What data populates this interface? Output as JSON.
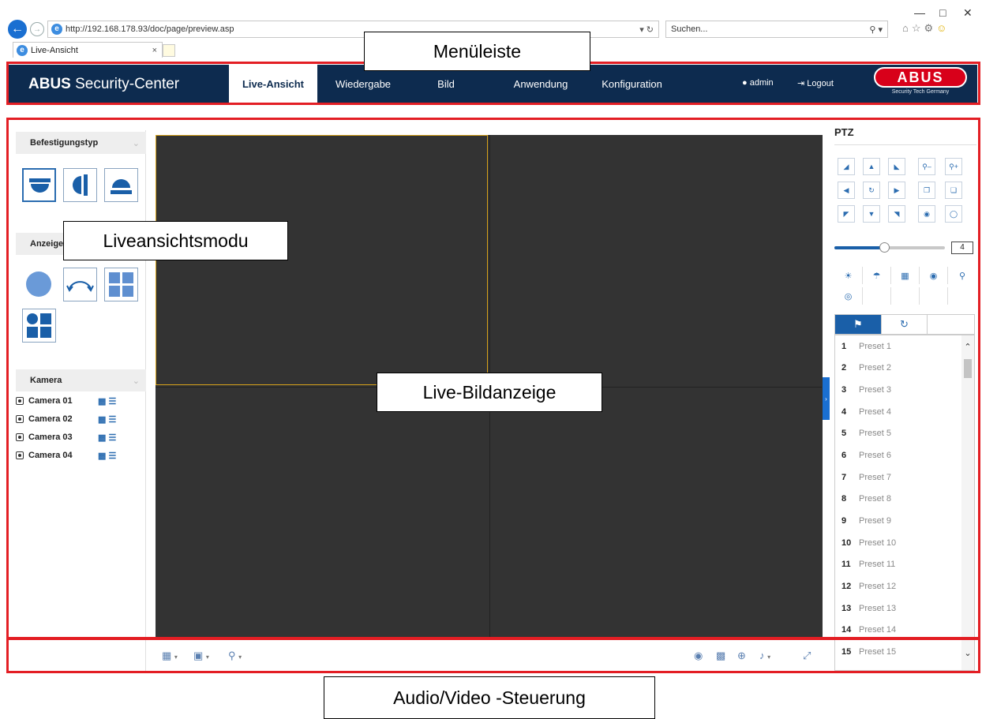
{
  "browser": {
    "url": "http://192.168.178.93/doc/page/preview.asp",
    "search_placeholder": "Suchen...",
    "tab_title": "Live-Ansicht",
    "tab_close": "×"
  },
  "header": {
    "brand_bold": "ABUS",
    "brand_rest": " Security-Center",
    "menu": [
      {
        "label": "Live-Ansicht",
        "active": true
      },
      {
        "label": "Wiedergabe",
        "active": false
      },
      {
        "label": "Bild",
        "active": false
      },
      {
        "label": "Anwendung",
        "active": false
      },
      {
        "label": "Konfiguration",
        "active": false
      }
    ],
    "user": "admin",
    "logout": "Logout",
    "logo": "ABUS",
    "logo_tagline": "Security Tech Germany",
    "bg_color": "#0d2b4f"
  },
  "left_panel": {
    "mount_type": "Befestigungstyp",
    "display_mode": "Anzeigen",
    "camera_section": "Kamera",
    "cameras": [
      "Camera 01",
      "Camera 02",
      "Camera 03",
      "Camera 04"
    ]
  },
  "ptz": {
    "title": "PTZ",
    "speed": "4",
    "speed_fraction": 0.5,
    "presets": [
      {
        "num": "1",
        "name": "Preset 1"
      },
      {
        "num": "2",
        "name": "Preset 2"
      },
      {
        "num": "3",
        "name": "Preset 3"
      },
      {
        "num": "4",
        "name": "Preset 4"
      },
      {
        "num": "5",
        "name": "Preset 5"
      },
      {
        "num": "6",
        "name": "Preset 6"
      },
      {
        "num": "7",
        "name": "Preset 7"
      },
      {
        "num": "8",
        "name": "Preset 8"
      },
      {
        "num": "9",
        "name": "Preset 9"
      },
      {
        "num": "10",
        "name": "Preset 10"
      },
      {
        "num": "11",
        "name": "Preset 11"
      },
      {
        "num": "12",
        "name": "Preset 12"
      },
      {
        "num": "13",
        "name": "Preset 13"
      },
      {
        "num": "14",
        "name": "Preset 14"
      },
      {
        "num": "15",
        "name": "Preset 15"
      }
    ]
  },
  "annotations": {
    "menu_bar": "Menüleiste",
    "live_view_mode": "Liveansichtsmodu",
    "live_image": "Live-Bildanzeige",
    "av_control": "Audio/Video -Steuerung",
    "highlight_color": "#e31e24"
  }
}
